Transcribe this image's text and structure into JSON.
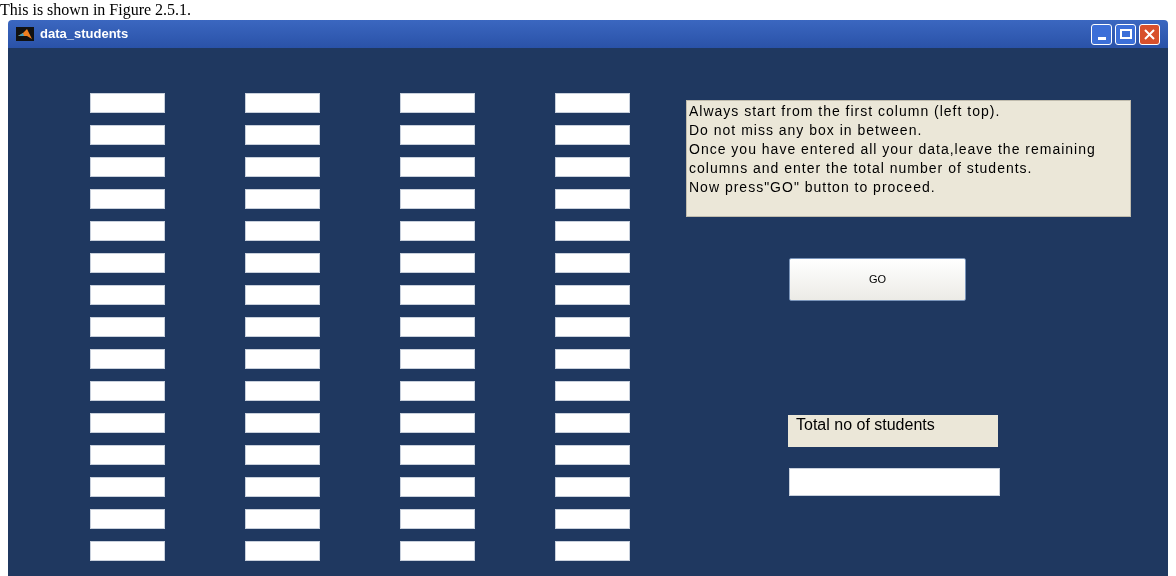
{
  "document_caption": "This is shown in Figure 2.5.1.",
  "window": {
    "title": "data_students"
  },
  "entry_columns": [
    {
      "fields": [
        {
          "kind": "text_field"
        },
        {
          "kind": "text_field"
        },
        {
          "kind": "text_field"
        },
        {
          "kind": "text_field"
        },
        {
          "kind": "text_field"
        },
        {
          "kind": "text_field"
        },
        {
          "kind": "text_field"
        },
        {
          "kind": "text_field"
        },
        {
          "kind": "text_field"
        },
        {
          "kind": "text_field"
        },
        {
          "kind": "text_field"
        },
        {
          "kind": "text_field"
        },
        {
          "kind": "text_field"
        },
        {
          "kind": "text_field"
        },
        {
          "kind": "text_field"
        }
      ]
    },
    {
      "fields": [
        {
          "kind": "text_field"
        },
        {
          "kind": "text_field"
        },
        {
          "kind": "text_field"
        },
        {
          "kind": "text_field"
        },
        {
          "kind": "text_field"
        },
        {
          "kind": "text_field"
        },
        {
          "kind": "text_field"
        },
        {
          "kind": "text_field"
        },
        {
          "kind": "text_field"
        },
        {
          "kind": "text_field"
        },
        {
          "kind": "text_field"
        },
        {
          "kind": "text_field"
        },
        {
          "kind": "text_field"
        },
        {
          "kind": "text_field"
        },
        {
          "kind": "text_field"
        }
      ]
    },
    {
      "fields": [
        {
          "kind": "text_field"
        },
        {
          "kind": "text_field"
        },
        {
          "kind": "text_field"
        },
        {
          "kind": "text_field"
        },
        {
          "kind": "text_field"
        },
        {
          "kind": "text_field"
        },
        {
          "kind": "text_field"
        },
        {
          "kind": "text_field"
        },
        {
          "kind": "text_field"
        },
        {
          "kind": "text_field"
        },
        {
          "kind": "text_field"
        },
        {
          "kind": "text_field"
        },
        {
          "kind": "text_field"
        },
        {
          "kind": "text_field"
        },
        {
          "kind": "text_field"
        }
      ]
    },
    {
      "fields": [
        {
          "kind": "text_field"
        },
        {
          "kind": "text_field"
        },
        {
          "kind": "text_field"
        },
        {
          "kind": "text_field"
        },
        {
          "kind": "text_field"
        },
        {
          "kind": "text_field"
        },
        {
          "kind": "text_field"
        },
        {
          "kind": "text_field"
        },
        {
          "kind": "text_field"
        },
        {
          "kind": "text_field"
        },
        {
          "kind": "text_field"
        },
        {
          "kind": "text_field"
        },
        {
          "kind": "text_field"
        },
        {
          "kind": "text_field"
        },
        {
          "kind": "text_field"
        }
      ]
    }
  ],
  "instructions": [
    "Always start from the first column (left top).",
    "Do not miss any box in between.",
    "Once you have entered all your data,leave the remaining columns and enter the total number of students.",
    "Now press\"GO\" button to proceed."
  ],
  "go_button": "GO",
  "total_label": "Total no of students"
}
